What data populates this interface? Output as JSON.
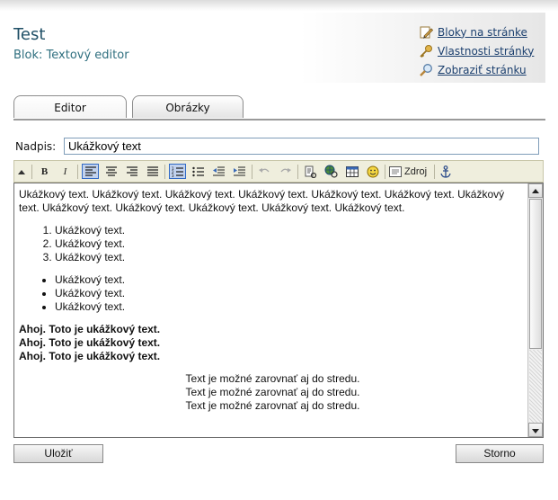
{
  "header": {
    "title": "Test",
    "subtitle": "Blok: Textový editor",
    "links": [
      {
        "label": "Bloky na stránke",
        "icon": "pencil-icon"
      },
      {
        "label": "Vlastnosti stránky",
        "icon": "key-icon"
      },
      {
        "label": "Zobraziť stránku",
        "icon": "magnifier-icon"
      }
    ]
  },
  "tabs": [
    {
      "label": "Editor",
      "active": true
    },
    {
      "label": "Obrázky",
      "active": false
    }
  ],
  "form": {
    "heading_label": "Nadpis:",
    "heading_value": "Ukážkový text"
  },
  "toolbar": {
    "buttons": [
      "collapse",
      "bold",
      "italic",
      "align-left",
      "align-center",
      "align-right",
      "justify",
      "ordered-list",
      "unordered-list",
      "outdent",
      "indent",
      "undo",
      "redo",
      "insert-link",
      "insert-web-link",
      "insert-table",
      "insert-smiley",
      "source",
      "anchor"
    ],
    "bold_label": "B",
    "italic_label": "I",
    "source_label": "Zdroj"
  },
  "editor": {
    "paragraph": "Ukážkový text. Ukážkový text. Ukážkový text. Ukážkový text. Ukážkový text. Ukážkový text. Ukážkový text. Ukážkový text. Ukážkový text. Ukážkový text. Ukážkový text. Ukážkový text.",
    "ordered_items": [
      "Ukážkový text.",
      "Ukážkový text.",
      "Ukážkový text."
    ],
    "unordered_items": [
      "Ukážkový text.",
      "Ukážkový text.",
      "Ukážkový text."
    ],
    "bold_lines": [
      "Ahoj. Toto je ukážkový text.",
      "Ahoj. Toto je ukážkový text.",
      "Ahoj. Toto je ukážkový text."
    ],
    "centered_lines": [
      "Text je možné zarovnať aj do stredu.",
      "Text je možné zarovnať aj do stredu.",
      "Text je možné zarovnať aj do stredu."
    ]
  },
  "actions": {
    "save_label": "Uložiť",
    "cancel_label": "Storno"
  },
  "colors": {
    "title": "#1f4f66",
    "toolbar_bg": "#efeedd",
    "active_button": "#c1d2ee"
  }
}
